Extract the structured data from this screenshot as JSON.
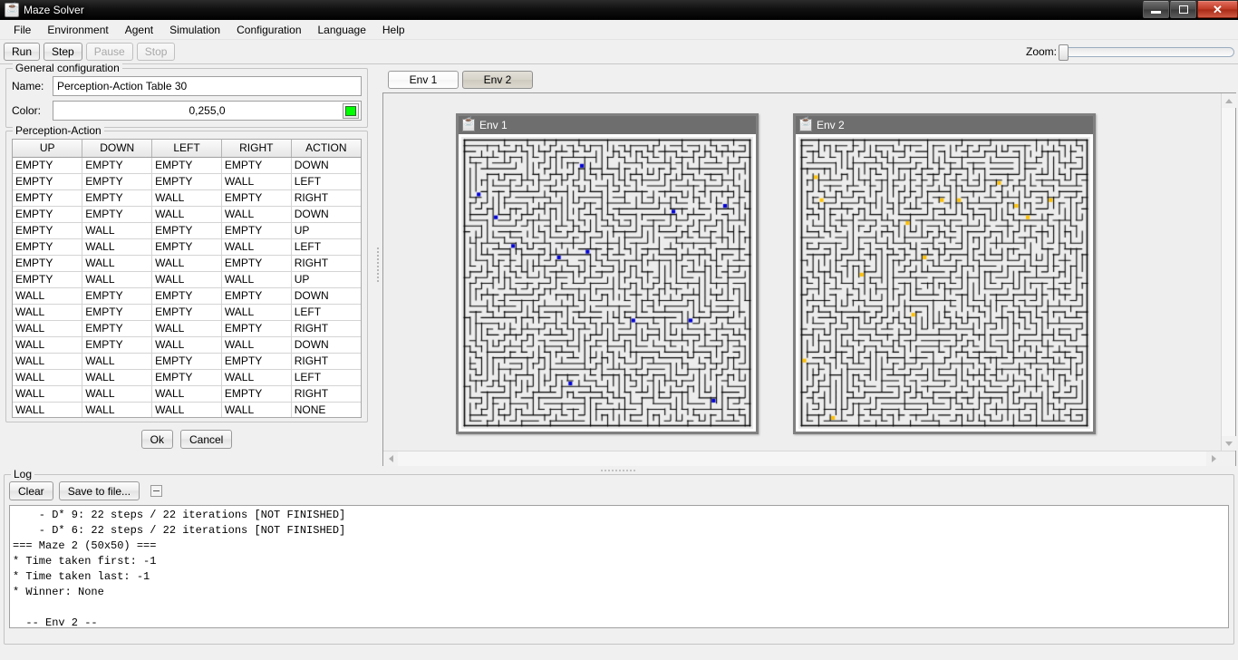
{
  "window": {
    "title": "Maze Solver",
    "icon": "java-coffee-cup-icon",
    "minimize_label": "Minimize",
    "maximize_label": "Maximize",
    "close_label": "✕"
  },
  "menu": {
    "items": [
      {
        "label": "File"
      },
      {
        "label": "Environment"
      },
      {
        "label": "Agent"
      },
      {
        "label": "Simulation"
      },
      {
        "label": "Configuration"
      },
      {
        "label": "Language"
      },
      {
        "label": "Help"
      }
    ]
  },
  "toolbar": {
    "run_label": "Run",
    "step_label": "Step",
    "pause_label": "Pause",
    "stop_label": "Stop",
    "zoom_label": "Zoom:",
    "zoom_value": "0"
  },
  "general_config": {
    "legend": "General configuration",
    "name_label": "Name:",
    "name_value": "Perception-Action Table 30",
    "color_label": "Color:",
    "color_value": "0,255,0",
    "color_hex": "#00ff00"
  },
  "perception_action": {
    "legend": "Perception-Action",
    "columns": [
      "UP",
      "DOWN",
      "LEFT",
      "RIGHT",
      "ACTION"
    ],
    "rows": [
      [
        "EMPTY",
        "EMPTY",
        "EMPTY",
        "EMPTY",
        "DOWN"
      ],
      [
        "EMPTY",
        "EMPTY",
        "EMPTY",
        "WALL",
        "LEFT"
      ],
      [
        "EMPTY",
        "EMPTY",
        "WALL",
        "EMPTY",
        "RIGHT"
      ],
      [
        "EMPTY",
        "EMPTY",
        "WALL",
        "WALL",
        "DOWN"
      ],
      [
        "EMPTY",
        "WALL",
        "EMPTY",
        "EMPTY",
        "UP"
      ],
      [
        "EMPTY",
        "WALL",
        "EMPTY",
        "WALL",
        "LEFT"
      ],
      [
        "EMPTY",
        "WALL",
        "WALL",
        "EMPTY",
        "RIGHT"
      ],
      [
        "EMPTY",
        "WALL",
        "WALL",
        "WALL",
        "UP"
      ],
      [
        "WALL",
        "EMPTY",
        "EMPTY",
        "EMPTY",
        "DOWN"
      ],
      [
        "WALL",
        "EMPTY",
        "EMPTY",
        "WALL",
        "LEFT"
      ],
      [
        "WALL",
        "EMPTY",
        "WALL",
        "EMPTY",
        "RIGHT"
      ],
      [
        "WALL",
        "EMPTY",
        "WALL",
        "WALL",
        "DOWN"
      ],
      [
        "WALL",
        "WALL",
        "EMPTY",
        "EMPTY",
        "RIGHT"
      ],
      [
        "WALL",
        "WALL",
        "EMPTY",
        "WALL",
        "LEFT"
      ],
      [
        "WALL",
        "WALL",
        "WALL",
        "EMPTY",
        "RIGHT"
      ],
      [
        "WALL",
        "WALL",
        "WALL",
        "WALL",
        "NONE"
      ]
    ]
  },
  "dialog_buttons": {
    "ok_label": "Ok",
    "cancel_label": "Cancel"
  },
  "env_tabs": [
    {
      "label": "Env 1",
      "active": false
    },
    {
      "label": "Env 2",
      "active": true
    }
  ],
  "mdi_windows": [
    {
      "title": "Env 1",
      "icon": "java-coffee-cup-icon",
      "marker_color": "#0000d8",
      "marker_count": 12
    },
    {
      "title": "Env 2",
      "icon": "java-coffee-cup-icon",
      "marker_color": "#ffc000",
      "marker_count": 14
    }
  ],
  "log": {
    "legend": "Log",
    "clear_label": "Clear",
    "save_label": "Save to file...",
    "collapse_label": "collapse-icon",
    "lines": "    - D* 9: 22 steps / 22 iterations [NOT FINISHED]\n    - D* 6: 22 steps / 22 iterations [NOT FINISHED]\n=== Maze 2 (50x50) ===\n* Time taken first: -1\n* Time taken last: -1\n* Winner: None\n\n  -- Env 2 --"
  }
}
